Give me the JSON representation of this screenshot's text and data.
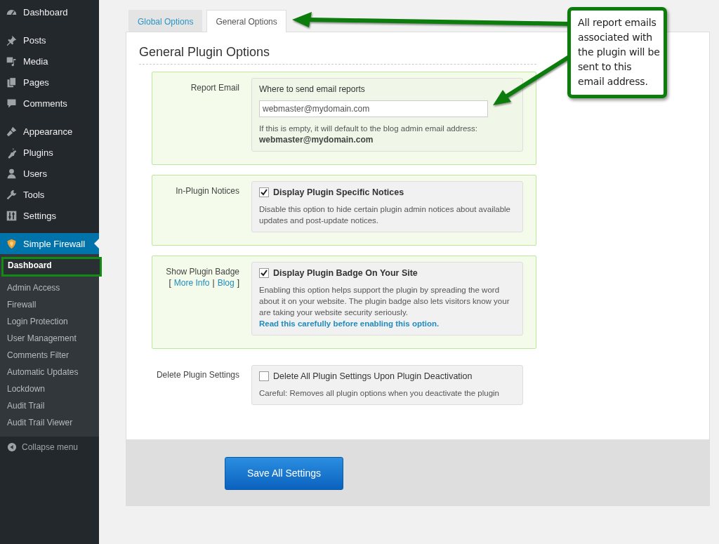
{
  "sidebar": {
    "menu_groups": [
      [
        {
          "label": "Dashboard",
          "selected": false
        }
      ],
      [
        {
          "label": "Posts",
          "selected": false
        },
        {
          "label": "Media",
          "selected": false
        },
        {
          "label": "Pages",
          "selected": false
        },
        {
          "label": "Comments",
          "selected": false
        }
      ],
      [
        {
          "label": "Appearance",
          "selected": false
        },
        {
          "label": "Plugins",
          "selected": false
        },
        {
          "label": "Users",
          "selected": false
        },
        {
          "label": "Tools",
          "selected": false
        },
        {
          "label": "Settings",
          "selected": false
        }
      ],
      [
        {
          "label": "Simple Firewall",
          "selected": true
        }
      ]
    ],
    "submenu": [
      {
        "label": "Dashboard",
        "selected": true,
        "outlined": true
      },
      {
        "label": "Admin Access",
        "selected": false,
        "outlined": false
      },
      {
        "label": "Firewall",
        "selected": false,
        "outlined": false
      },
      {
        "label": "Login Protection",
        "selected": false,
        "outlined": false
      },
      {
        "label": "User Management",
        "selected": false,
        "outlined": false
      },
      {
        "label": "Comments Filter",
        "selected": false,
        "outlined": false
      },
      {
        "label": "Automatic Updates",
        "selected": false,
        "outlined": false
      },
      {
        "label": "Lockdown",
        "selected": false,
        "outlined": false
      },
      {
        "label": "Audit Trail",
        "selected": false,
        "outlined": false
      },
      {
        "label": "Audit Trail Viewer",
        "selected": false,
        "outlined": false
      }
    ],
    "collapse": "Collapse menu"
  },
  "tabs": [
    {
      "label": "Global Options",
      "selected": false
    },
    {
      "label": "General Options",
      "selected": true
    }
  ],
  "heading": "General Plugin Options",
  "sections": [
    {
      "highlighted": true,
      "label": "Report Email",
      "kind": "text",
      "heading": "Where to send email reports",
      "value": "webmaster@mydomain.com",
      "help": "If this is empty, it will default to the blog admin email address:",
      "help_bold": "webmaster@mydomain.com"
    },
    {
      "highlighted": true,
      "label": "In-Plugin Notices",
      "kind": "checkbox",
      "checked": true,
      "title": "Display Plugin Specific Notices",
      "description": "Disable this option to hide certain plugin admin notices about available updates and post-update notices."
    },
    {
      "highlighted": true,
      "label": "Show Plugin Badge",
      "links": [
        "More Info",
        "Blog"
      ],
      "link_marks": [
        "[",
        "|",
        "]"
      ],
      "kind": "checkbox",
      "checked": true,
      "title": "Display Plugin Badge On Your Site",
      "description": "Enabling this option helps support the plugin by spreading the word about it on your website. The plugin badge also lets visitors know your are taking your website security seriously.",
      "link": "Read this carefully before enabling this option."
    },
    {
      "label": "Delete Plugin Settings",
      "kind": "checkbox",
      "checked": false,
      "title": "Delete All Plugin Settings Upon Plugin Deactivation",
      "description": "Careful: Removes all plugin options when you deactivate the plugin"
    }
  ],
  "save_button": "Save All Settings",
  "callout": "All report emails associated with the plugin will be sent to this email address."
}
